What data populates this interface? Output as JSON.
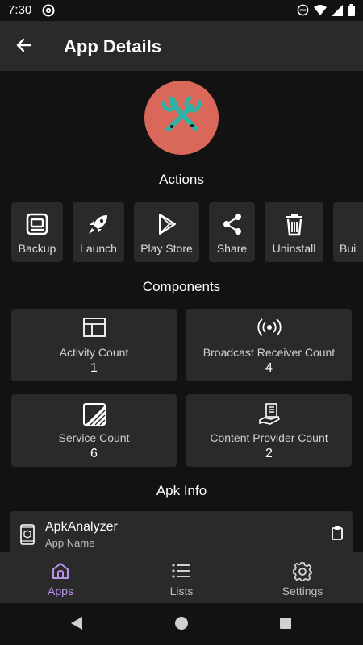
{
  "status_bar": {
    "time": "7:30",
    "icons": [
      "at-sign-icon",
      "do-not-disturb-icon",
      "wifi-icon",
      "cellular-icon",
      "battery-icon"
    ]
  },
  "app_bar": {
    "title": "App Details",
    "back_icon": "arrow-back-icon"
  },
  "app_icon": {
    "name": "tools-icon",
    "color": "#d9675a"
  },
  "actions": {
    "title": "Actions",
    "items": [
      {
        "label": "Backup",
        "icon": "backup-icon"
      },
      {
        "label": "Launch",
        "icon": "rocket-icon"
      },
      {
        "label": "Play Store",
        "icon": "play-store-icon"
      },
      {
        "label": "Share",
        "icon": "share-icon"
      },
      {
        "label": "Uninstall",
        "icon": "trash-icon"
      },
      {
        "label": "Bui",
        "icon": "build-icon"
      }
    ]
  },
  "components": {
    "title": "Components",
    "items": [
      {
        "label": "Activity Count",
        "value": "1",
        "icon": "activity-layout-icon"
      },
      {
        "label": "Broadcast Receiver Count",
        "value": "4",
        "icon": "broadcast-icon"
      },
      {
        "label": "Service Count",
        "value": "6",
        "icon": "service-icon"
      },
      {
        "label": "Content Provider Count",
        "value": "2",
        "icon": "content-provider-icon"
      }
    ]
  },
  "apk_info": {
    "title": "Apk Info",
    "items": [
      {
        "value": "ApkAnalyzer",
        "label": "App Name",
        "icon": "phone-package-icon",
        "action_icon": "clipboard-icon"
      }
    ]
  },
  "bottom_nav": {
    "items": [
      {
        "label": "Apps",
        "icon": "home-icon",
        "active": true
      },
      {
        "label": "Lists",
        "icon": "list-icon",
        "active": false
      },
      {
        "label": "Settings",
        "icon": "gear-icon",
        "active": false
      }
    ]
  },
  "colors": {
    "background": "#121212",
    "surface": "#2a2a2a",
    "accent": "#b794e6",
    "icon_circle": "#d9675a",
    "tool_color": "#2fb3a6"
  }
}
